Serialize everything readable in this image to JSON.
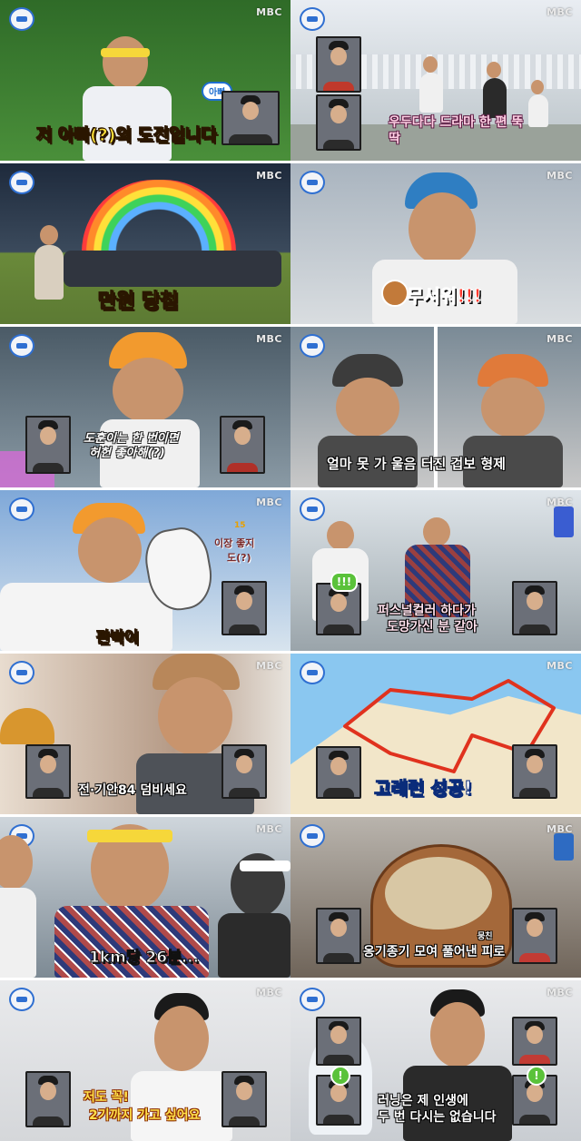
{
  "broadcaster_logo": "MBC",
  "panels": [
    {
      "id": "p1",
      "bubble": "아빠",
      "caption": "저 아빠(?)의 도전입니다",
      "colors": {
        "bg_top": "#2f6b28",
        "bg_bottom": "#4a8f3a"
      }
    },
    {
      "id": "p2",
      "caption": "우두다다 드라마 한 편 뚝딱",
      "colors": {
        "bg_top": "#e9edf2",
        "bg_bottom": "#b9c2c7"
      }
    },
    {
      "id": "p3",
      "caption": "만원 당첨",
      "colors": {
        "bg_top": "#1e2a3c",
        "bg_bottom": "#6a8a3a"
      }
    },
    {
      "id": "p4",
      "caption": "무서워!!!",
      "colors": {
        "bg_top": "#a9b4bf",
        "bg_bottom": "#d9dde0"
      }
    },
    {
      "id": "p5",
      "caption_line1": "도훈이는 한 번이면",
      "caption_line2": "허헌 좋아해(?)",
      "colors": {
        "bg_top": "#4a5a66",
        "bg_bottom": "#8a9aa5"
      }
    },
    {
      "id": "p6",
      "caption": "얼마 못 가 울음 터진 겁보 형제",
      "colors": {
        "bg_top": "#7a8a96",
        "bg_bottom": "#c8c8c8"
      }
    },
    {
      "id": "p7",
      "caption": "판박이",
      "side_note_line1": "이장 좋지",
      "side_note_line2": "도(?)",
      "counter": "15",
      "colors": {
        "bg_top": "#7fa8d8",
        "bg_bottom": "#d8e4ee"
      }
    },
    {
      "id": "p8",
      "caption_line1": "퍼스널컬러 하다가",
      "caption_line2": "도망가신 분 같아",
      "excl_text": "!!!",
      "colors": {
        "bg_top": "#dfe5ea",
        "bg_bottom": "#9aa4aa"
      }
    },
    {
      "id": "p9",
      "caption": "전·기안84 덤비세요",
      "colors": {
        "bg_top": "#b59a86",
        "bg_bottom": "#e8dccf"
      }
    },
    {
      "id": "p10",
      "caption": "고래런 성공!",
      "colors": {
        "bg_top": "#8ac7f0",
        "bg_bottom": "#f2e6c9"
      }
    },
    {
      "id": "p11",
      "caption": "1km당 26분...",
      "colors": {
        "bg_top": "#cfd6dc",
        "bg_bottom": "#7d8a94"
      }
    },
    {
      "id": "p12",
      "caption_small": "뭉친",
      "caption": "옹기종기 모여 풀어낸 피로",
      "colors": {
        "bg_top": "#b9b4ad",
        "bg_bottom": "#6f6459"
      }
    },
    {
      "id": "p13",
      "caption_line1": "저도 꼭!",
      "caption_line2": "2기까지 가고 싶어요",
      "colors": {
        "bg_top": "#e9eaec",
        "bg_bottom": "#d5d7da"
      }
    },
    {
      "id": "p14",
      "caption_line1": "러닝은 제 인생에",
      "caption_line2": "두 번 다시는 없습니다",
      "colors": {
        "bg_top": "#e9eaec",
        "bg_bottom": "#c9cdd2"
      }
    }
  ]
}
